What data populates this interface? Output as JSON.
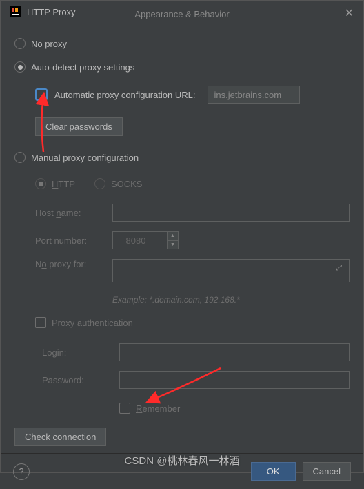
{
  "title": "HTTP Proxy",
  "behind_tab": "Appearance & Behavior",
  "options": {
    "no_proxy": "No proxy",
    "auto_detect": "Auto-detect proxy settings",
    "pac_label": "Automatic proxy configuration URL:",
    "pac_url": "ins.jetbrains.com",
    "clear_passwords": "Clear passwords",
    "manual": "Manual proxy configuration",
    "http": "HTTP",
    "socks": "SOCKS"
  },
  "fields": {
    "host_label": "Host name:",
    "host_value": "",
    "port_label": "Port number:",
    "port_value": "8080",
    "noproxy_label": "No proxy for:",
    "noproxy_value": "",
    "example": "Example: *.domain.com, 192.168.*",
    "auth_label": "Proxy authentication",
    "login_label": "Login:",
    "login_value": "",
    "password_label": "Password:",
    "password_value": "",
    "remember": "Remember"
  },
  "buttons": {
    "check": "Check connection",
    "ok": "OK",
    "cancel": "Cancel"
  },
  "watermark": "CSDN @桃林春风一林酒"
}
